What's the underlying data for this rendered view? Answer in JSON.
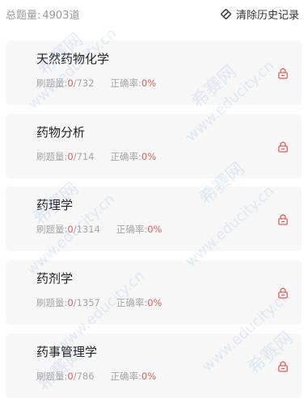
{
  "header": {
    "total_label": "总题量:",
    "total_value": "4903道",
    "clear_label": "清除历史记录"
  },
  "labels": {
    "done": "刷题量:",
    "accuracy": "正确率:"
  },
  "items": [
    {
      "title": "天然药物化学",
      "done": "0",
      "total": "/732",
      "accuracy": "0%"
    },
    {
      "title": "药物分析",
      "done": "0",
      "total": "/714",
      "accuracy": "0%"
    },
    {
      "title": "药理学",
      "done": "0",
      "total": "/1314",
      "accuracy": "0%"
    },
    {
      "title": "药剂学",
      "done": "0",
      "total": "/1357",
      "accuracy": "0%"
    },
    {
      "title": "药事管理学",
      "done": "0",
      "total": "/786",
      "accuracy": "0%"
    }
  ],
  "watermark": {
    "url": "www.educity.cn",
    "brand": "希赛网"
  },
  "icons": {
    "clear": "broom-diamond-icon",
    "lock": "lock-icon"
  },
  "colors": {
    "accent_red": "#e85a55",
    "muted_text": "#a6a6a6",
    "card_bg": "#f7f7f7",
    "watermark": "#78aae6"
  }
}
